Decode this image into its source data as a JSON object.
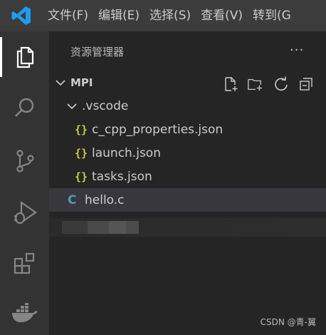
{
  "menu": [
    "文件(F)",
    "编辑(E)",
    "选择(S)",
    "查看(V)",
    "转到(G"
  ],
  "activity_bar": [
    "explorer",
    "search",
    "source-control",
    "run-debug",
    "extensions",
    "docker"
  ],
  "explorer": {
    "title": "资源管理器",
    "more_actions": "···",
    "toolbar": [
      "new-file",
      "new-folder",
      "refresh",
      "collapse-all"
    ]
  },
  "tree": {
    "root": "MPI",
    "subfolder": ".vscode",
    "json_icon": "{}",
    "c_icon": "C",
    "files": {
      "cpp_props": "c_cpp_properties.json",
      "launch": "launch.json",
      "tasks": "tasks.json",
      "hello": "hello.c"
    }
  },
  "watermark": "CSDN @青-翼",
  "colors": {
    "accent": "#007acc",
    "json": "#cbcb41",
    "c_file": "#519aba",
    "selected_row": "#37373d"
  }
}
